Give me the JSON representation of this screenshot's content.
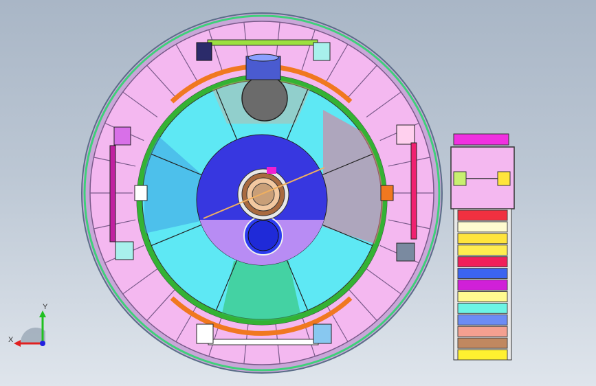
{
  "viewport": {
    "background_top": "#a9b6c6",
    "background_bottom": "#dfe5ec"
  },
  "model": {
    "ring_panel_color": "#f4b8f0",
    "inner_cyan": "#5ee8f4",
    "core_blue": "#3737e0",
    "core_purple": "#b88cf4",
    "green_ring": "#34b234",
    "orange_ring": "#f07820",
    "side_panel_colors": [
      "#f03040",
      "#fffbd0",
      "#ffe43c",
      "#ffec50",
      "#f0205a",
      "#3c64f0",
      "#d020d8",
      "#fffa90",
      "#6cf4e4",
      "#6c8cf4",
      "#f4a090",
      "#c08860",
      "#fff030"
    ]
  },
  "triad": {
    "x_label": "X",
    "y_label": "Y",
    "x_color": "#e02020",
    "y_color": "#20c020",
    "z_color": "#2020e0"
  }
}
